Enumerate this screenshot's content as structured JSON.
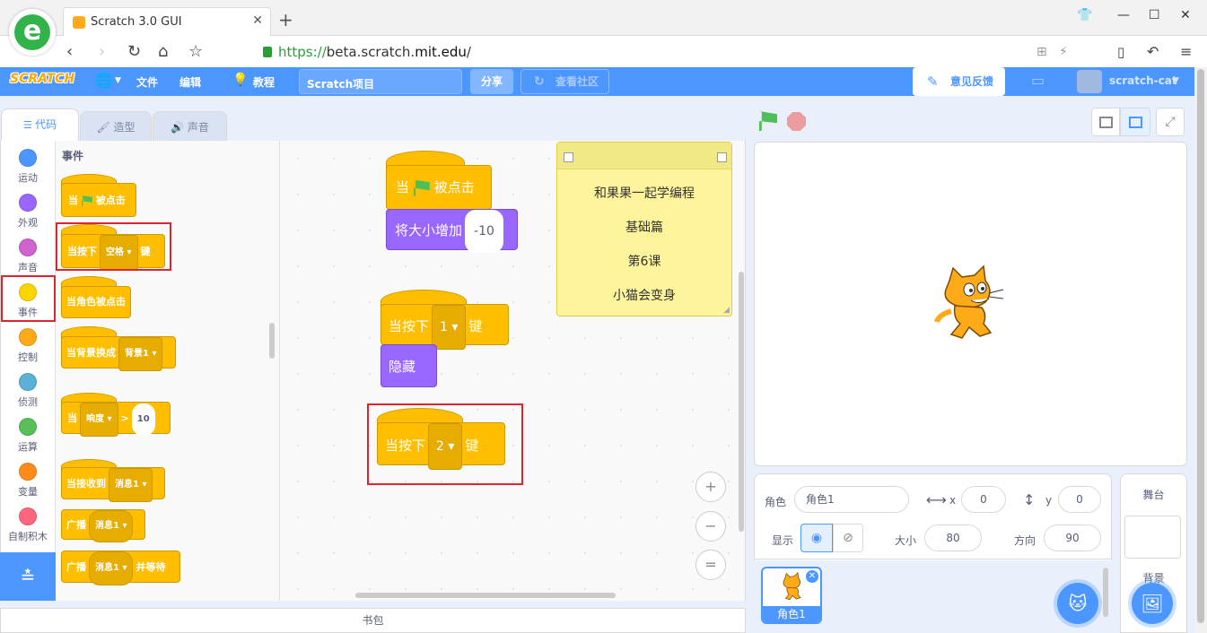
{
  "browser": {
    "tab_title": "Scratch 3.0 GUI",
    "url_scheme": "https://",
    "url_sub": "beta.scratch.",
    "url_domain": "mit.edu",
    "url_path": "/"
  },
  "menubar": {
    "logo": "SCRATCH",
    "file": "文件",
    "edit": "编辑",
    "tutorial": "教程",
    "project_title": "Scratch项目",
    "share": "分享",
    "community": "查看社区",
    "feedback": "意见反馈",
    "username": "scratch-cat"
  },
  "tabs": {
    "code": "代码",
    "costumes": "造型",
    "sounds": "声音"
  },
  "categories": [
    {
      "label": "运动",
      "color": "#4c97ff"
    },
    {
      "label": "外观",
      "color": "#9966ff"
    },
    {
      "label": "声音",
      "color": "#cf63cf"
    },
    {
      "label": "事件",
      "color": "#ffd500"
    },
    {
      "label": "控制",
      "color": "#ffab19"
    },
    {
      "label": "侦测",
      "color": "#5cb1d6"
    },
    {
      "label": "运算",
      "color": "#59c059"
    },
    {
      "label": "变量",
      "color": "#ff8c1a"
    },
    {
      "label": "自制积木",
      "color": "#ff6680"
    }
  ],
  "flyout": {
    "heading": "事件",
    "when_flag_a": "当",
    "when_flag_b": "被点击",
    "when_key_a": "当按下",
    "when_key_dd": "空格",
    "when_key_b": "键",
    "when_sprite_clicked": "当角色被点击",
    "when_backdrop_a": "当背景换成",
    "when_backdrop_dd": "背景1",
    "when_loud_a": "当",
    "when_loud_dd": "响度",
    "when_loud_op": ">",
    "when_loud_val": "10",
    "when_receive_a": "当接收到",
    "when_receive_dd": "消息1",
    "broadcast_a": "广播",
    "broadcast_dd": "消息1",
    "broadcast_wait_a": "广播",
    "broadcast_wait_dd": "消息1",
    "broadcast_wait_b": "并等待"
  },
  "script1": {
    "hat_a": "当",
    "hat_b": "被点击",
    "change_label": "将大小增加",
    "change_value": "-10"
  },
  "script2": {
    "hat_a": "当按下",
    "key": "1",
    "hat_b": "键",
    "hide": "隐藏"
  },
  "script3": {
    "hat_a": "当按下",
    "key": "2",
    "hat_b": "键"
  },
  "note": {
    "lines": [
      "和果果一起学编程",
      "基础篇",
      "第6课",
      "小猫会变身"
    ]
  },
  "zoom": {
    "in": "+",
    "out": "−",
    "reset": "="
  },
  "backpack": "书包",
  "sprite_info": {
    "sprite_label": "角色",
    "sprite_name": "角色1",
    "x_label": "x",
    "x_value": "0",
    "y_label": "y",
    "y_value": "0",
    "show_label": "显示",
    "size_label": "大小",
    "size_value": "80",
    "direction_label": "方向",
    "direction_value": "90"
  },
  "sprite_list": [
    {
      "name": "角色1"
    }
  ],
  "stage_pane": {
    "title": "舞台",
    "backdrop_label": "背景"
  }
}
